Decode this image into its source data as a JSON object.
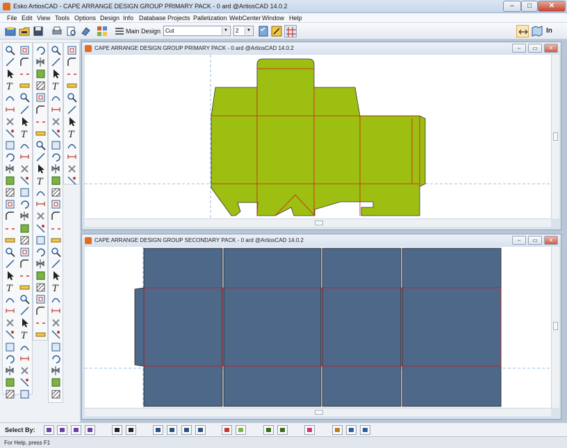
{
  "app": {
    "title": "Esko ArtiosCAD - CAPE ARRANGE DESIGN GROUP PRIMARY PACK - 0 ard @ArtiosCAD 14.0.2",
    "window_controls": {
      "minimize": "–",
      "maximize": "□",
      "close": "✕"
    }
  },
  "menu": [
    "File",
    "Edit",
    "View",
    "Tools",
    "Options",
    "Design",
    "Info",
    "Database",
    "Projects",
    "Palletization",
    "WebCenter",
    "Window",
    "Help"
  ],
  "toolbar": {
    "main_design_label": "Main Design",
    "line_type_value": "Cut",
    "pointage_value": "2",
    "unit_label": "In"
  },
  "documents": {
    "primary": {
      "title": "CAPE ARRANGE DESIGN GROUP PRIMARY PACK - 0 ard @ArtiosCAD 14.0.2",
      "fill_color": "#9dbf12"
    },
    "secondary": {
      "title": "CAPE ARRANGE DESIGN GROUP SECONDARY PACK - 0 ard @ArtiosCAD 14.0.2",
      "fill_color": "#4d6889"
    },
    "doc_controls": {
      "minimize": "–",
      "restore": "▭",
      "close": "✕"
    },
    "crease_color": "#d11a1a",
    "guide_color": "#7aa7d6"
  },
  "select_bar": {
    "label": "Select By:"
  },
  "status": {
    "text": "For Help, press F1"
  },
  "icons": {
    "toolbar": [
      "new-design-icon",
      "open-icon",
      "save-icon",
      "print-icon",
      "print-preview-icon",
      "3d-icon",
      "layers-icon",
      "main-design-icon",
      "line-type-combo",
      "pointage-combo",
      "checklist-icon",
      "user-tool-icon",
      "grid-icon",
      "view-mode-icon",
      "map-icon"
    ],
    "palette": [
      "zoom",
      "line",
      "select",
      "text",
      "arc",
      "dimension",
      "delete",
      "trim",
      "scale",
      "rotate",
      "mirror",
      "fill",
      "hatch",
      "offset",
      "bevel",
      "bridge",
      "ruler"
    ]
  }
}
